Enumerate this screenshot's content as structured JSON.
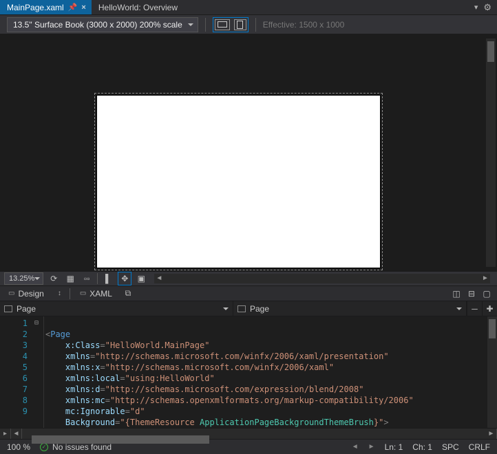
{
  "tabs": {
    "active": {
      "label": "MainPage.xaml",
      "pinned": true
    },
    "second": {
      "label": "HelloWorld: Overview"
    }
  },
  "toolbar": {
    "device": "13.5\" Surface Book (3000 x 2000) 200% scale",
    "effective": "Effective: 1500 x 1000"
  },
  "zoom": {
    "percent": "13.25%"
  },
  "panes": {
    "design": "Design",
    "xaml": "XAML"
  },
  "outline": {
    "left": "Page",
    "right": "Page"
  },
  "status": {
    "zoom": "100 %",
    "issues": "No issues found",
    "ln": "Ln: 1",
    "ch": "Ch: 1",
    "spc": "SPC",
    "end": "CRLF"
  },
  "code": {
    "lines": [
      "1",
      "2",
      "3",
      "4",
      "5",
      "6",
      "7",
      "8",
      "9"
    ],
    "l1_tag": "Page",
    "l2_attr": "x:Class",
    "l2_str": "HelloWorld.MainPage",
    "l3_attr": "xmlns",
    "l3_str": "http://schemas.microsoft.com/winfx/2006/xaml/presentation",
    "l4_attr": "xmlns:x",
    "l4_str": "http://schemas.microsoft.com/winfx/2006/xaml",
    "l5_attr": "xmlns:local",
    "l5_str": "using:HelloWorld",
    "l6_attr": "xmlns:d",
    "l6_str": "http://schemas.microsoft.com/expression/blend/2008",
    "l7_attr": "xmlns:mc",
    "l7_str": "http://schemas.openxmlformats.org/markup-compatibility/2006",
    "l8_attr": "mc:Ignorable",
    "l8_str": "d",
    "l9_attr": "Background",
    "l9_pre": "{ThemeResource ",
    "l9_type": "ApplicationPageBackgroundThemeBrush",
    "l9_post": "}"
  }
}
